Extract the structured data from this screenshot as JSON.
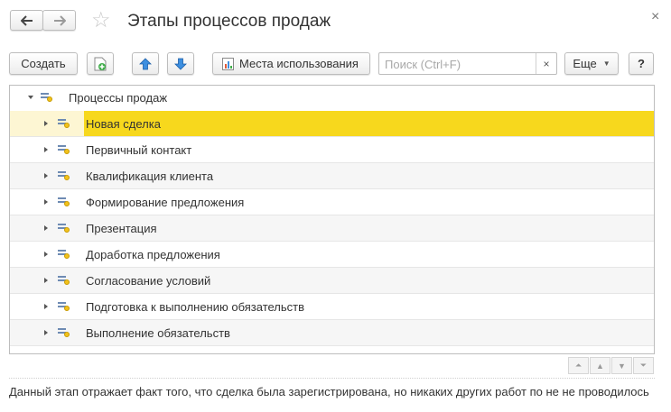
{
  "window": {
    "title": "Этапы процессов продаж",
    "close_glyph": "×"
  },
  "toolbar": {
    "create_label": "Создать",
    "usage_label": "Места использования",
    "search_placeholder": "Поиск (Ctrl+F)",
    "search_value": "",
    "search_clear": "×",
    "more_label": "Еще",
    "help_label": "?"
  },
  "tree": {
    "root_label": "Процессы продаж",
    "items": [
      {
        "label": "Новая сделка",
        "selected": true
      },
      {
        "label": "Первичный контакт"
      },
      {
        "label": "Квалификация клиента"
      },
      {
        "label": "Формирование предложения"
      },
      {
        "label": "Презентация"
      },
      {
        "label": "Доработка предложения"
      },
      {
        "label": "Согласование условий"
      },
      {
        "label": "Подготовка к выполнению обязательств"
      },
      {
        "label": "Выполнение обязательств"
      }
    ]
  },
  "description": "Данный этап отражает факт того, что сделка была зарегистрирована, но никаких других работ по не не проводилось",
  "colors": {
    "selection": "#f7d81d",
    "selection_row": "#fdf6d3",
    "arrow_blue": "#3d8fe0"
  }
}
